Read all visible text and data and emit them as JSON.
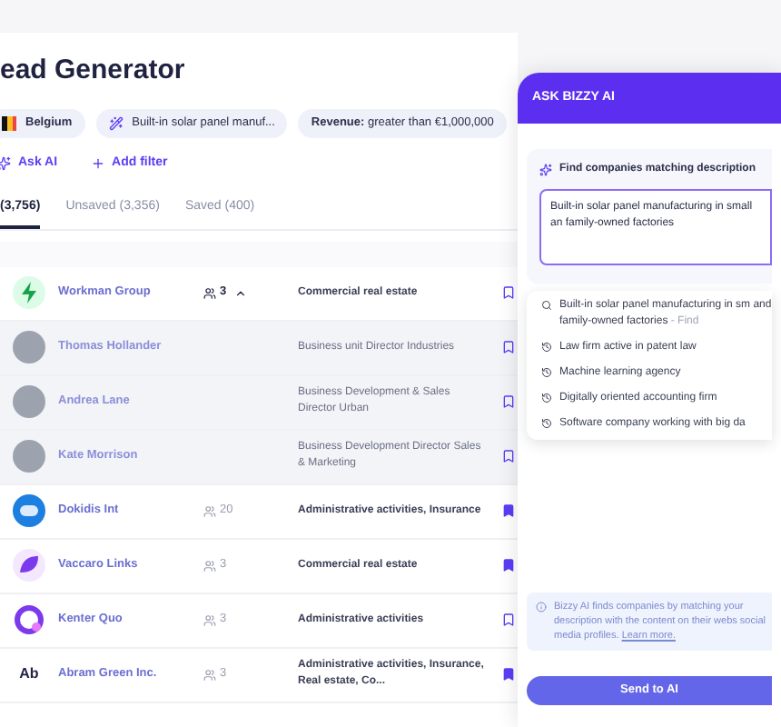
{
  "title": "ead Generator",
  "filters": [
    {
      "kind": "flag",
      "label": "Belgium"
    },
    {
      "kind": "ai",
      "label": "Built-in solar panel manuf..."
    },
    {
      "kind": "field",
      "label": "Revenue:",
      "value": "greater than €1,000,000"
    }
  ],
  "actions": [
    {
      "kind": "ai",
      "label": "Ask AI"
    },
    {
      "kind": "add",
      "label": "Add filter"
    }
  ],
  "tabs": [
    {
      "label": "(3,756)",
      "selected": true
    },
    {
      "label": "Unsaved (3,356)",
      "selected": false
    },
    {
      "label": "Saved (400)",
      "selected": false
    }
  ],
  "rows": [
    {
      "kind": "company",
      "logo": {
        "kind": "bolt"
      },
      "name": "Workman Group",
      "count": "3",
      "expanded": true,
      "industry": "Commercial real estate",
      "saved": false
    },
    {
      "kind": "person",
      "name": "Thomas Hollander",
      "industry": "Business unit Director Industries",
      "saved": false
    },
    {
      "kind": "person",
      "name": "Andrea Lane",
      "industry": "Business Development & Sales Director Urban",
      "saved": false
    },
    {
      "kind": "person",
      "name": "Kate Morrison",
      "industry": "Business Development Director Sales & Marketing",
      "saved": false
    },
    {
      "kind": "company",
      "logo": {
        "kind": "chat"
      },
      "name": "Dokidis Int",
      "count": "20",
      "expanded": false,
      "industry": "Administrative activities, Insurance",
      "saved": true
    },
    {
      "kind": "company",
      "logo": {
        "kind": "leaf"
      },
      "name": "Vaccaro Links",
      "count": "3",
      "expanded": false,
      "industry": "Commercial real estate",
      "saved": true
    },
    {
      "kind": "company",
      "logo": {
        "kind": "ring"
      },
      "name": "Kenter Quo",
      "count": "3",
      "expanded": false,
      "industry": "Administrative activities",
      "saved": false
    },
    {
      "kind": "company",
      "logo": {
        "kind": "initials",
        "text": "Ab"
      },
      "name": "Abram Green Inc.",
      "count": "3",
      "expanded": false,
      "industry": "Administrative activities, Insurance, Real estate, Co...",
      "saved": true
    }
  ],
  "panel": {
    "title": "ASK BIZZY AI",
    "section": "Find companies matching description",
    "input": "Built-in solar panel manufacturing in small an family-owned factories",
    "suggestions": [
      {
        "kind": "search",
        "text": "Built-in solar panel manufacturing in sm and family-owned factories",
        "hint": "- Find"
      },
      {
        "kind": "history",
        "text": "Law firm active in patent law"
      },
      {
        "kind": "history",
        "text": "Machine learning agency"
      },
      {
        "kind": "history",
        "text": "Digitally oriented accounting firm"
      },
      {
        "kind": "history",
        "text": "Software company working with big da"
      }
    ],
    "info": "Bizzy AI finds companies by matching your description with the content on their webs social media profiles.",
    "info_link": "Learn more.",
    "button": "Send to AI"
  }
}
